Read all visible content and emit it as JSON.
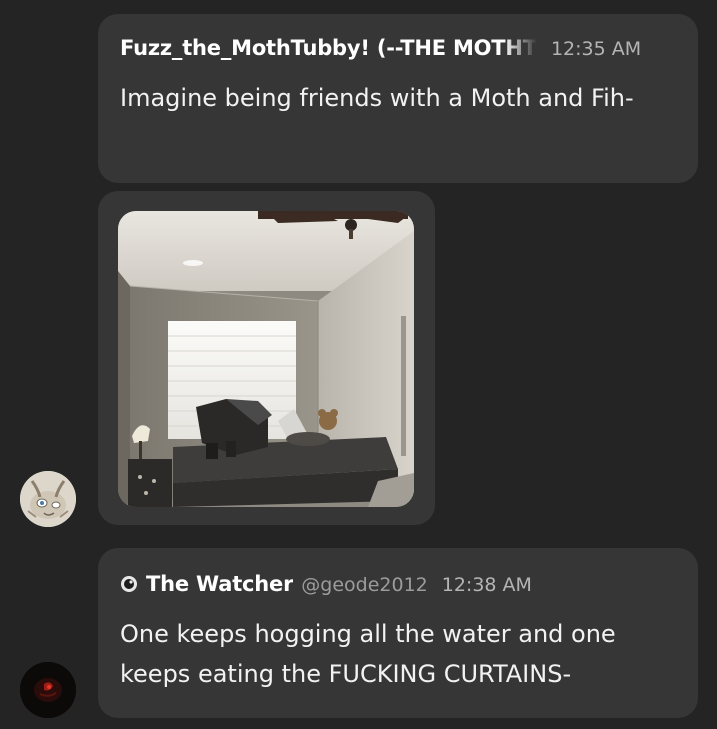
{
  "messages": [
    {
      "username": "Fuzz_the_MothTubby! (--THE MOTHT",
      "timestamp": "12:35 AM",
      "text": "Imagine being friends with a Moth and Fih-"
    },
    {
      "username": "The Watcher",
      "handle": "@geode2012",
      "timestamp": "12:38 AM",
      "text": "One keeps hogging all the water and one keeps eating the FUCKING CURTAINS-"
    }
  ],
  "icons": {
    "avatar1": "moth-avatar",
    "avatar2": "dark-red-avatar",
    "username_badge": "eye-icon"
  },
  "colors": {
    "background": "#242424",
    "bubble": "#363636",
    "text": "#f2f2f2",
    "muted": "#9c9c9c"
  }
}
